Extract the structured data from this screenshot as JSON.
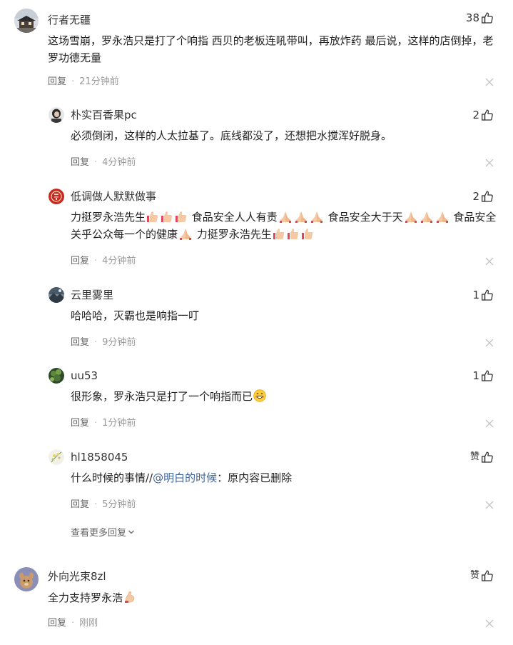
{
  "accent_color": "#406599",
  "like_label": "赞",
  "reply_label": "回复",
  "comments": [
    {
      "user": "行者无疆",
      "likes": "38",
      "text": "这场雪崩，罗永浩只是打了个响指 西贝的老板连吼带叫，再放炸药 最后说，这样的店倒掉，老罗功德无量",
      "time": "21分钟前",
      "avatar_icon": "house-photo-avatar"
    },
    {
      "user": "外向光束8zl",
      "likes": "",
      "text": "全力支持罗永浩",
      "time": "刚刚",
      "avatar_icon": "cartoon-animal-avatar"
    }
  ],
  "replies": [
    {
      "user": "朴实百香果pc",
      "likes": "2",
      "text": "必须倒闭，这样的人太拉基了。底线都没了，还想把水搅浑好脱身。",
      "time": "4分钟前",
      "avatar_icon": "portrait-avatar"
    },
    {
      "user": "低调做人默默做事",
      "likes": "2",
      "text_parts": [
        "力挺罗永浩先生",
        "食品安全人人有责",
        "食品安全大于天",
        "食品安全关乎公众每一个的健康",
        "力挺罗永浩先生"
      ],
      "time": "4分钟前",
      "avatar_icon": "red-seal-avatar"
    },
    {
      "user": "云里雾里",
      "likes": "1",
      "text": "哈哈哈，灭霸也是响指一叮",
      "time": "9分钟前",
      "avatar_icon": "landscape-avatar"
    },
    {
      "user": "uu53",
      "likes": "1",
      "text": "很形象，罗永浩只是打了一个响指而已",
      "time": "1分钟前",
      "avatar_icon": "green-plant-avatar"
    },
    {
      "user": "hl1858045",
      "likes": "",
      "text_prefix": "什么时候的事情//",
      "mention": "@明白的时候",
      "text_suffix": "：原内容已删除",
      "time": "5分钟前",
      "avatar_icon": "flower-avatar"
    }
  ],
  "view_more": "查看更多回复"
}
